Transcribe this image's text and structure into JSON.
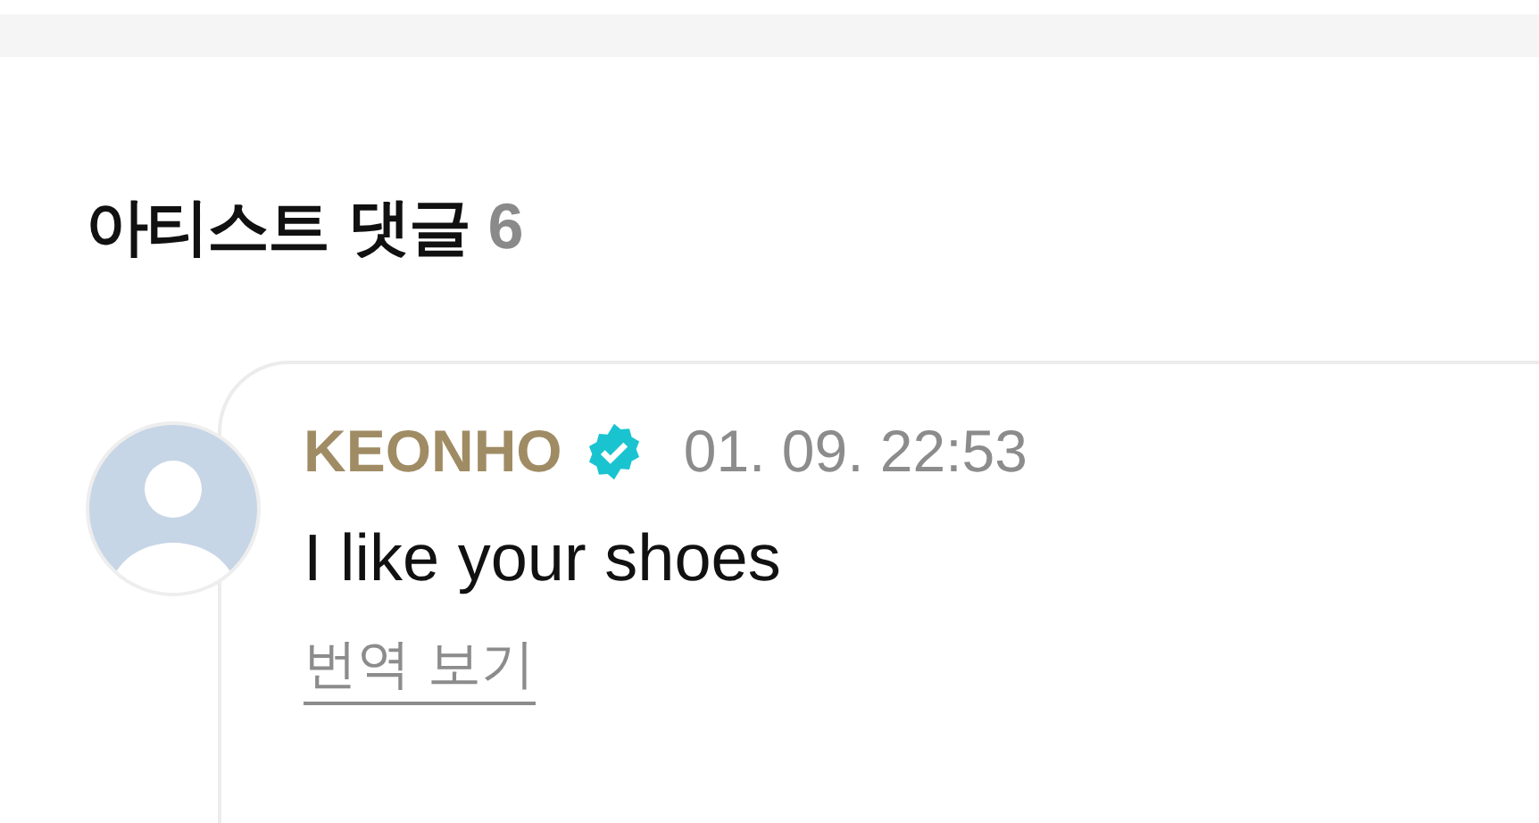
{
  "section": {
    "title": "아티스트 댓글",
    "count": "6"
  },
  "comments": [
    {
      "author": "KEONHO",
      "verified": true,
      "time": "01. 09. 22:53",
      "text": "I like your shoes",
      "translate": "번역 보기"
    }
  ]
}
